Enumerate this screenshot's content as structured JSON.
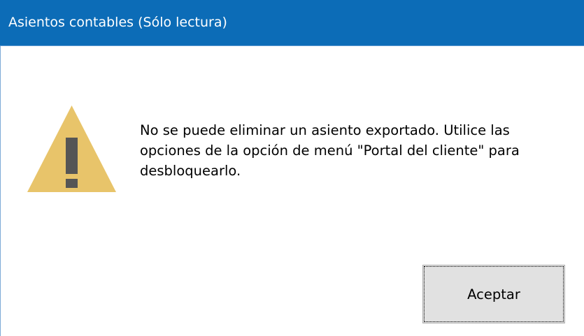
{
  "window": {
    "title": "Asientos contables (Sólo lectura)",
    "title_bar_color": "#0c6cb7"
  },
  "dialog": {
    "icon": "warning-icon",
    "icon_color": "#e8c46a",
    "message_lines": [
      "No se puede eliminar un asiento exportado. Utilice las",
      "opciones de la opción de menú \"Portal del cliente\" para",
      "desbloquearlo."
    ]
  },
  "buttons": {
    "ok_label": "Aceptar"
  }
}
